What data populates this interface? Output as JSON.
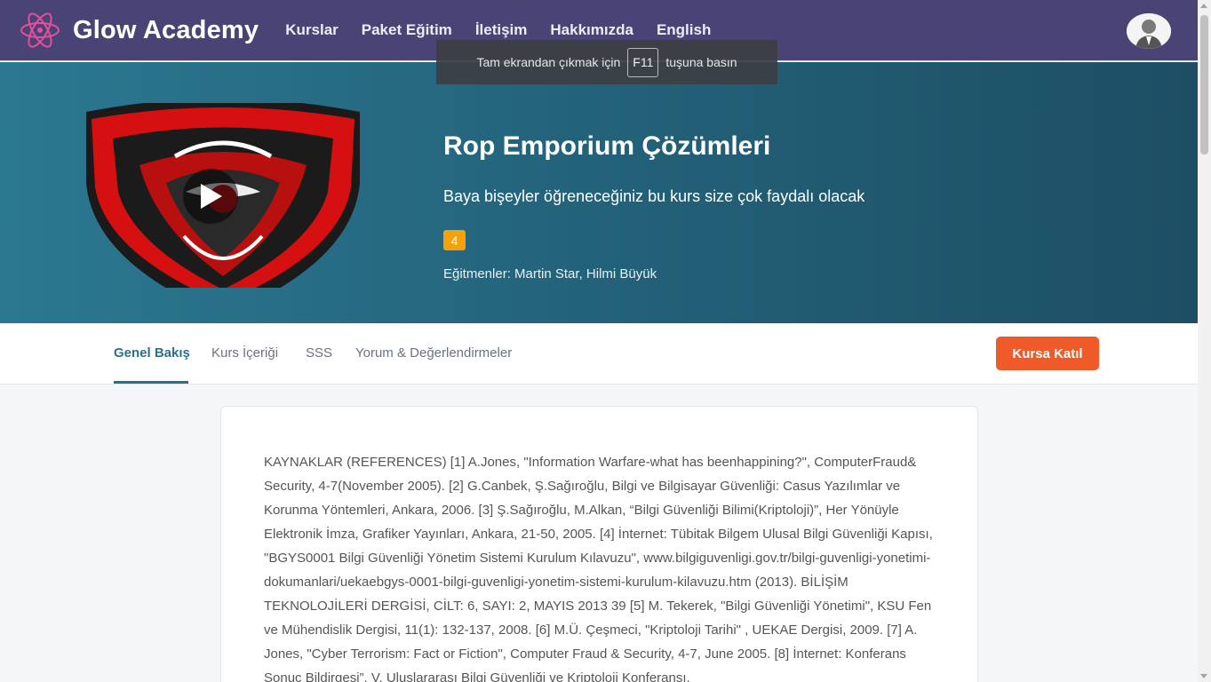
{
  "nav": {
    "brand": "Glow Academy",
    "links": [
      "Kurslar",
      "Paket Eğitim",
      "İletişim",
      "Hakkımızda",
      "English"
    ]
  },
  "fullscreen_toast": {
    "before": "Tam ekrandan çıkmak için",
    "key": "F11",
    "after": "tuşuna basın"
  },
  "course": {
    "title": "Rop Emporium Çözümleri",
    "subtitle": "Baya bişeyler öğreneceğiniz bu kurs size çok faydalı olacak",
    "rating": "4",
    "instructors_label": "Eğitmenler:",
    "instructors": "Martin Star, Hilmi Büyük"
  },
  "tabs": [
    "Genel Bakış",
    "Kurs İçeriği",
    "SSS",
    "Yorum & Değerlendirmeler"
  ],
  "join_button": "Kursa Katıl",
  "content_text": "KAYNAKLAR (REFERENCES) [1] A.Jones, \"Information Warfare-what has beenhappining?\", ComputerFraud& Security, 4-7(November 2005). [2] G.Canbek, Ş.Sağıroğlu, Bilgi ve Bilgisayar Güvenliği: Casus Yazılımlar ve Korunma Yöntemleri, Ankara, 2006. [3] Ş.Sağıroğlu, M.Alkan, “Bilgi Güvenliği Bilimi(Kriptoloji)”, Her Yönüyle Elektronik İmza, Grafiker Yayınları, Ankara, 21-50, 2005. [4] İnternet: Tübitak Bilgem Ulusal Bilgi Güvenliği Kapısı, \"BGYS0001 Bilgi Güvenliği Yönetim Sistemi Kurulum Kılavuzu\", www.bilgiguvenligi.gov.tr/bilgi-guvenligi-yonetimi-dokumanlari/uekaebgys-0001-bilgi-guvenligi-yonetim-sistemi-kurulum-kilavuzu.htm (2013). BİLİŞİM TEKNOLOJİLERİ DERGİSİ, CİLT: 6, SAYI: 2, MAYIS 2013 39 [5] M. Tekerek, \"Bilgi Güvenliği Yönetimi\", KSU Fen ve Mühendislik Dergisi, 11(1): 132-137, 2008. [6] M.Ü. Çeşmeci, \"Kriptoloji Tarihi\" , UEKAE Dergisi, 2009. [7] A. Jones, \"Cyber Terrorism: Fact or Fiction\", Computer Fraud & Security, 4-7, June 2005. [8] İnternet: Konferans Sonuç Bildirgesi”, V. Uluslararası Bilgi Güvenliği ve Kriptoloji Konferansı,",
  "icons": {
    "logo": "atom-icon",
    "avatar": "user-avatar-icon",
    "play": "play-icon"
  },
  "colors": {
    "navbar": "#4a4476",
    "hero_start": "#2b7891",
    "hero_end": "#1d4e64",
    "accent": "#f05a28",
    "tab_active": "#2d6f8a",
    "rating_badge": "#f5a20a",
    "logo": "#e64f9b"
  }
}
